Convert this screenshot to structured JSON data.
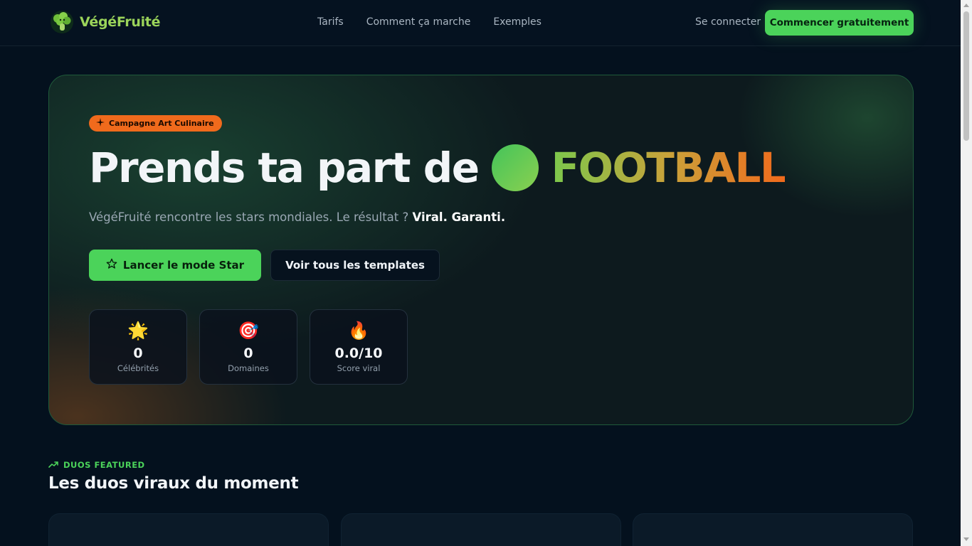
{
  "header": {
    "brand": "VégéFruité",
    "nav": [
      "Tarifs",
      "Comment ça marche",
      "Exemples"
    ],
    "login_label": "Se connecter",
    "cta_label": "Commencer gratuitement"
  },
  "hero": {
    "badge": "Campagne Art Culinaire",
    "headline_prefix": "Prends ta part de",
    "headline_word": "FOOTBALL",
    "subtitle_text": "VégéFruité rencontre les stars mondiales. Le résultat ?",
    "subtitle_bold": "Viral. Garanti.",
    "primary_button": "Lancer le mode Star",
    "secondary_button": "Voir tous les templates",
    "stats": [
      {
        "icon": "🌟",
        "value": "0",
        "label": "Célébrités"
      },
      {
        "icon": "🎯",
        "value": "0",
        "label": "Domaines"
      },
      {
        "icon": "🔥",
        "value": "0.0/10",
        "label": "Score viral"
      }
    ]
  },
  "section": {
    "tag": "DUOS FEATURED",
    "title": "Les duos viraux du moment"
  },
  "colors": {
    "background": "#04111e",
    "accent_green": "#4bd35a",
    "accent_orange": "#f06a1c"
  }
}
